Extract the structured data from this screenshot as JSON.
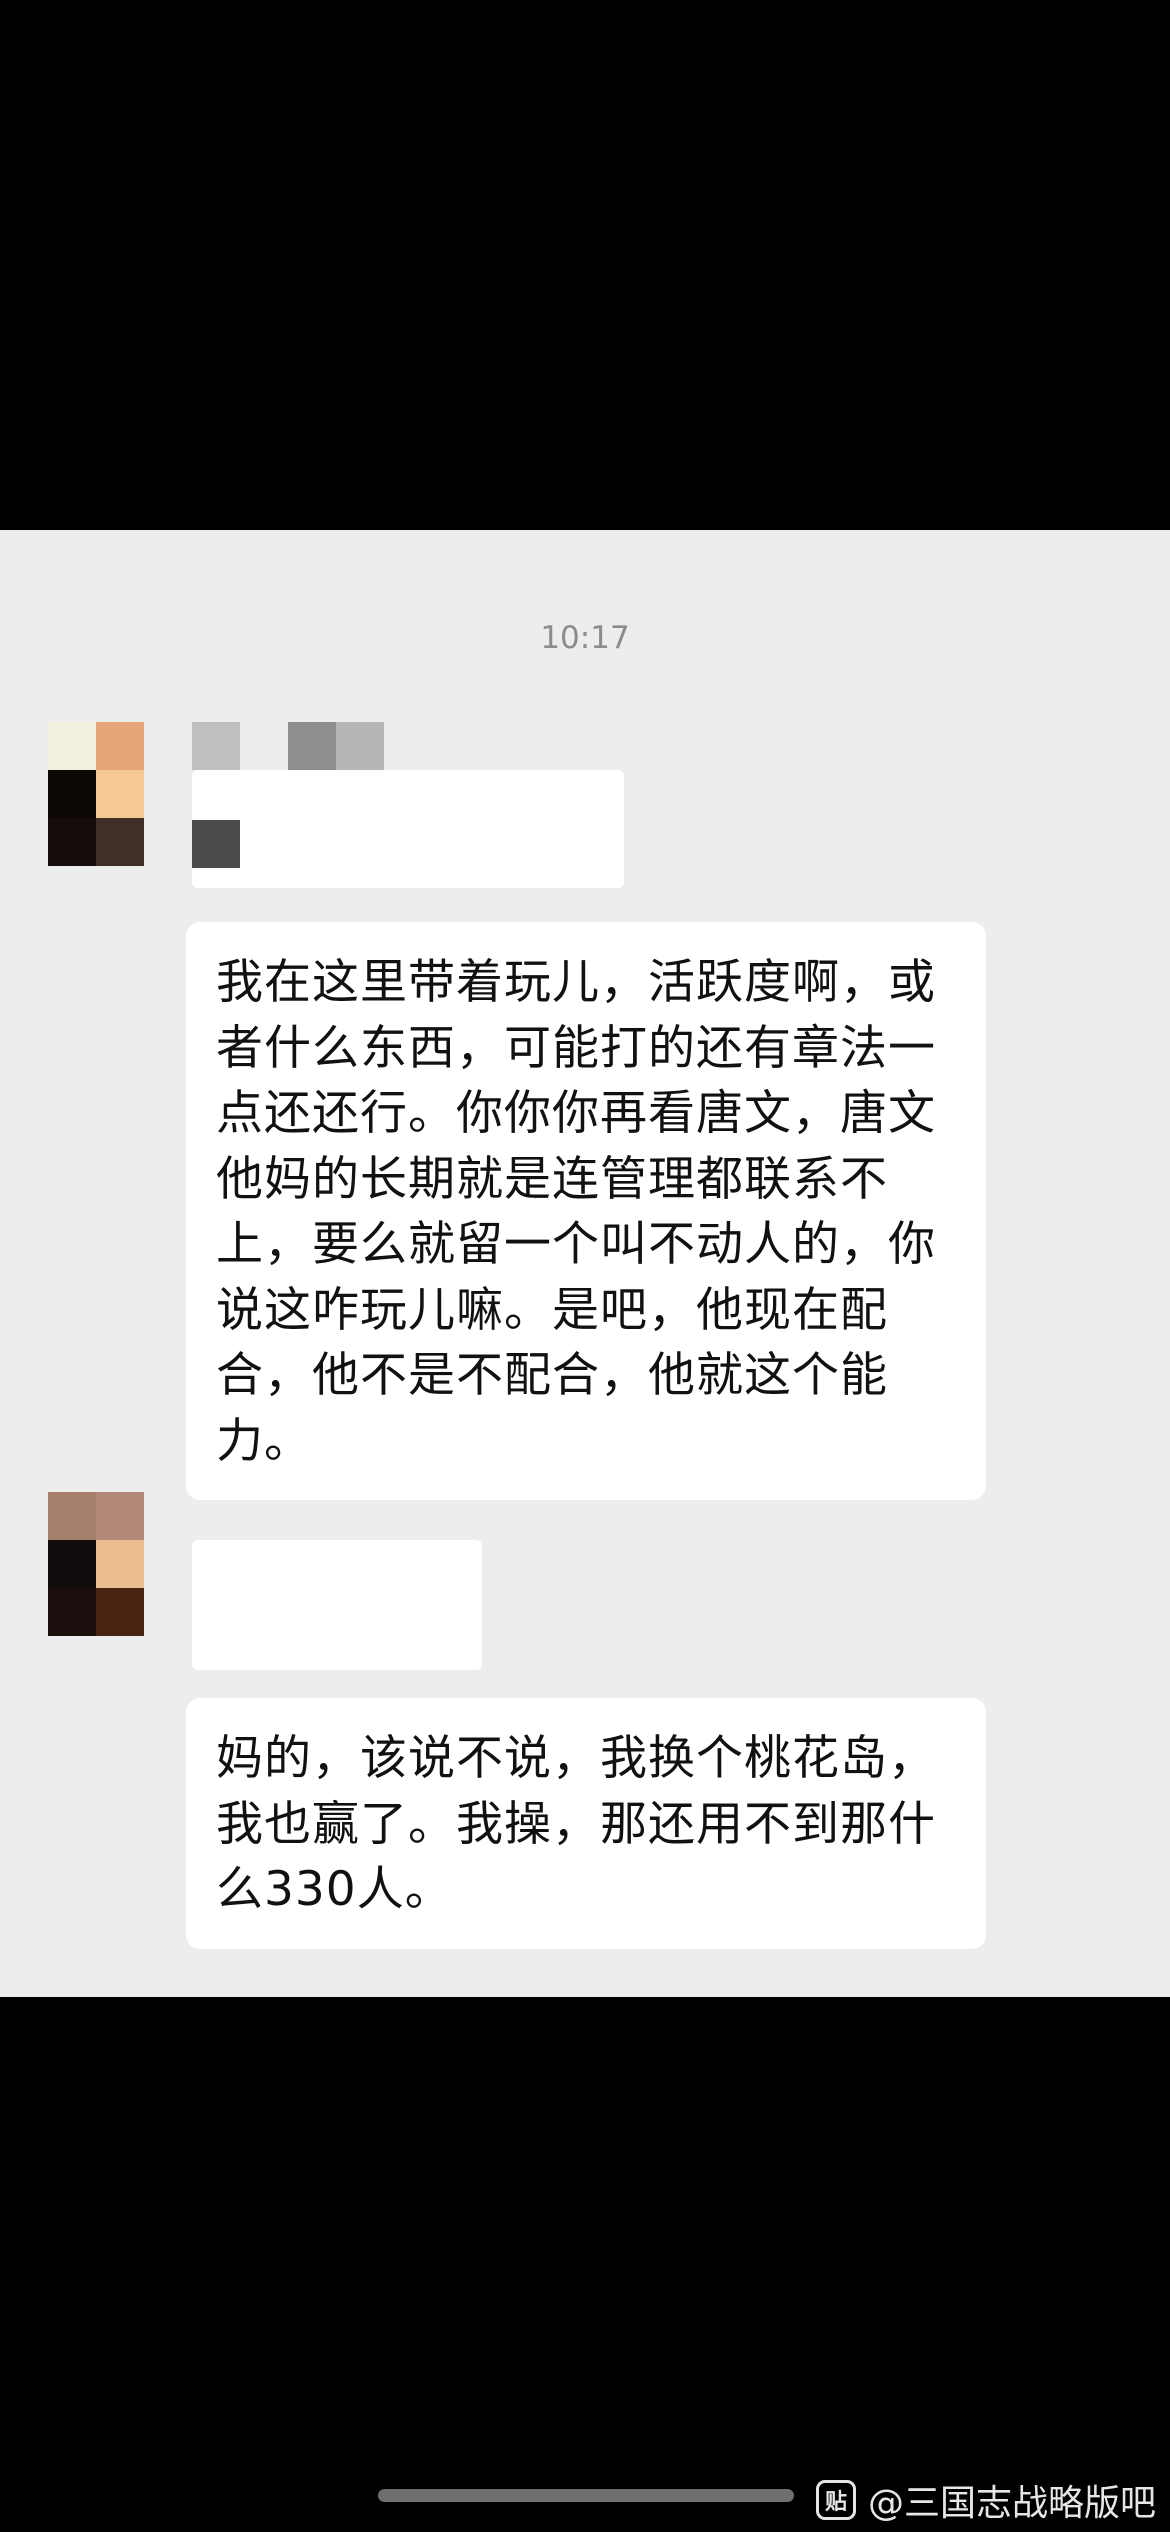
{
  "chat": {
    "timestamp": "10:17",
    "messages": [
      {
        "text": "我在这里带着玩儿，活跃度啊，或者什么东西，可能打的还有章法一点还还行。你你你再看唐文，唐文他妈的长期就是连管理都联系不上，要么就留一个叫不动人的，你说这咋玩儿嘛。是吧，他现在配合，他不是不配合，他就这个能力。"
      },
      {
        "text": "妈的，该说不说，我换个桃花岛，我也赢了。我操，那还用不到那什么330人。"
      }
    ]
  },
  "avatars": {
    "first_colors": [
      "#f1efe0",
      "#e9a57a",
      "#0d0907",
      "#f5c994",
      "#150c0c",
      "#3e3026"
    ],
    "second_colors": [
      "#a57e6c",
      "#b38a7a",
      "#120b0b",
      "#eebf8e",
      "#1a0e0c",
      "#4a2412"
    ]
  },
  "sender_name_blur": {
    "colors": [
      "#c0c0c0",
      "#8e8e8e",
      "#b6b6b6",
      "#4a4a4a"
    ]
  },
  "watermark": {
    "logo_text": "贴",
    "text": "@三国志战略版吧"
  }
}
